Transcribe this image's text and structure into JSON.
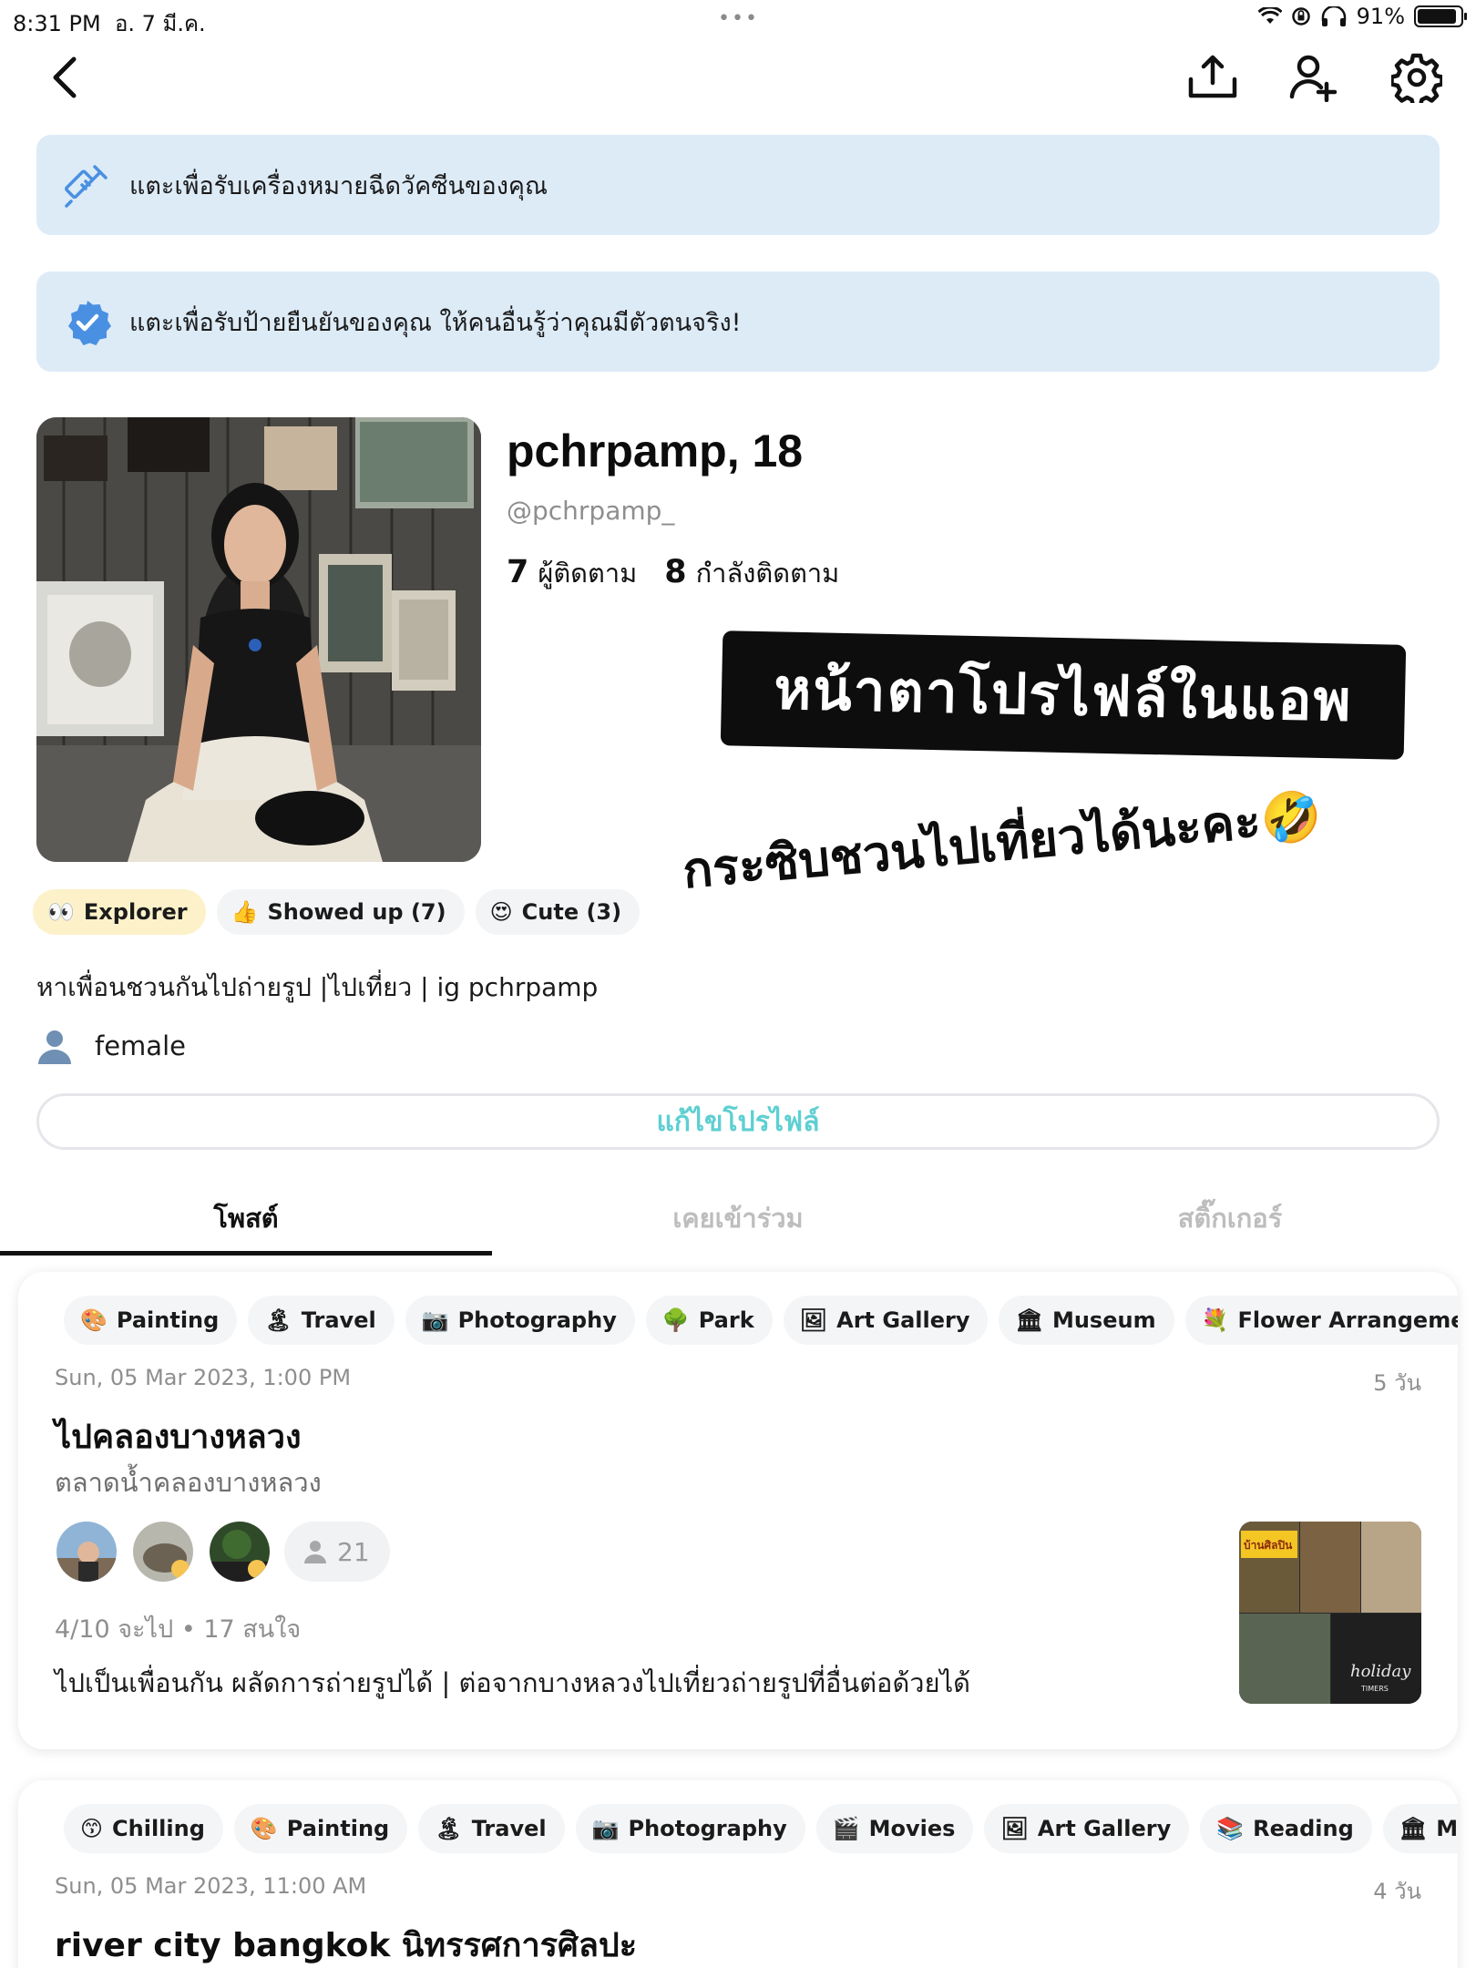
{
  "status_bar": {
    "time": "8:31 PM",
    "date": "อ. 7 มี.ค.",
    "battery": "91%"
  },
  "banners": {
    "vaccine": "แตะเพื่อรับเครื่องหมายฉีดวัคซีนของคุณ",
    "verify": "แตะเพื่อรับป้ายยืนยันของคุณ ให้คนอื่นรู้ว่าคุณมีตัวตนจริง!"
  },
  "profile": {
    "name": "pchrpamp, 18",
    "handle": "@pchrpamp_",
    "followers_count": "7",
    "followers_label": "ผู้ติดตาม",
    "following_count": "8",
    "following_label": "กำลังติดตาม",
    "bio": "หาเพื่อนชวนกันไปถ่ายรูป |ไปเที่ยว |  ig pchrpamp",
    "gender": "female",
    "edit_label": "แก้ไขโปรไฟล์"
  },
  "stickers": {
    "line1": "หน้าตาโปรไฟล์ในแอพ",
    "line2": "กระซิบชวนไปเที่ยวได้นะคะ🤣"
  },
  "badges": [
    {
      "emoji": "👀",
      "label": "Explorer"
    },
    {
      "emoji": "👍",
      "label": "Showed up (7)"
    },
    {
      "emoji": "😍",
      "label": "Cute (3)"
    }
  ],
  "tabs": [
    "โพสต์",
    "เคยเข้าร่วม",
    "สติ๊กเกอร์"
  ],
  "posts": [
    {
      "tags": [
        {
          "emoji": "🎨",
          "label": "Painting"
        },
        {
          "emoji": "🏝",
          "label": "Travel"
        },
        {
          "emoji": "📷",
          "label": "Photography"
        },
        {
          "emoji": "🌳",
          "label": "Park"
        },
        {
          "emoji": "🖼",
          "label": "Art Gallery"
        },
        {
          "emoji": "🏛",
          "label": "Museum"
        },
        {
          "emoji": "💐",
          "label": "Flower Arrangement"
        }
      ],
      "date": "Sun, 05 Mar 2023, 1:00 PM",
      "ago": "5 วัน",
      "title": "ไปคลองบางหลวง",
      "subtitle": "ตลาดน้ำคลองบางหลวง",
      "attendee_count": "21",
      "meta": "4/10 จะไป • 17 สนใจ",
      "description": "ไปเป็นเพื่อนกัน ผลัดการถ่ายรูปได้ | ต่อจากบางหลวงไปเที่ยวถ่ายรูปที่อื่นต่อด้วยได้",
      "thumb_text_top": "บ้านศิลปิน",
      "thumb_text_bottom": "holiday",
      "thumb_text_bottom2": "TIMERS"
    },
    {
      "tags": [
        {
          "emoji": "😙",
          "label": "Chilling"
        },
        {
          "emoji": "🎨",
          "label": "Painting"
        },
        {
          "emoji": "🏝",
          "label": "Travel"
        },
        {
          "emoji": "📷",
          "label": "Photography"
        },
        {
          "emoji": "🎬",
          "label": "Movies"
        },
        {
          "emoji": "🖼",
          "label": "Art Gallery"
        },
        {
          "emoji": "📚",
          "label": "Reading"
        },
        {
          "emoji": "🏛",
          "label": "Museum"
        },
        {
          "emoji": "💐",
          "label": ""
        }
      ],
      "date": "Sun, 05 Mar 2023, 11:00 AM",
      "ago": "4 วัน",
      "title": "river city bangkok นิทรรศการศิลปะ"
    }
  ],
  "colors": {
    "banner_bg": "#ddebf7",
    "accent_teal": "#5ecfd2",
    "icon_blue": "#4a90e2"
  },
  "icons": {
    "back": "chevron-left-icon",
    "share": "share-upload-icon",
    "add_friend": "add-person-icon",
    "settings": "gear-icon",
    "vaccine": "syringe-icon",
    "verified": "verified-badge-icon",
    "gender": "person-silhouette-icon",
    "attendees": "person-icon"
  }
}
